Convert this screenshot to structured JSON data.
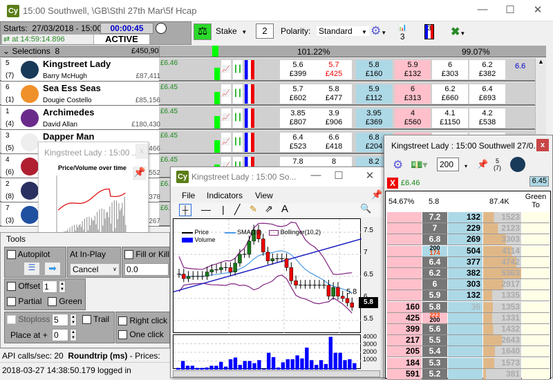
{
  "window": {
    "title": "15:00 Southwell,  \\GB\\Sthl 27th Mar\\5f Hcap",
    "logo": "Cy"
  },
  "info": {
    "starts_label": "Starts:",
    "starts_value": "27/03/2018 - 15:00",
    "countdown": "00:00:45",
    "refresh": "at 14:59:14.896",
    "status": "ACTIVE"
  },
  "toolbar": {
    "stake_label": "Stake",
    "stake_value": "2",
    "polarity_label": "Polarity:",
    "polarity_value": "Standard",
    "chart_count": "3",
    "ladder_count": "3"
  },
  "grid": {
    "selections_label": "Selections",
    "selections_count": "8",
    "matched": "£450,905",
    "back_book": "101.22%",
    "lay_book": "99.07%"
  },
  "runners": [
    {
      "num": "5",
      "draw": "(7)",
      "name": "Kingstreet Lady",
      "jockey": "Barry McHugh",
      "matched": "£87,411",
      "ltp_stake": "£6.46",
      "silk": "#1a3a5a",
      "prices": [
        [
          "5.6",
          "£399"
        ],
        [
          "5.7",
          "£425"
        ],
        [
          "5.8",
          "£160"
        ],
        [
          "5.9",
          "£132"
        ],
        [
          "6",
          "£303"
        ],
        [
          "6.2",
          "£382"
        ]
      ],
      "ltp": "6.6"
    },
    {
      "num": "6",
      "draw": "(1)",
      "name": "Sea Ess Seas",
      "jockey": "Dougie Costello",
      "matched": "£85,156",
      "ltp_stake": "£6.45",
      "silk": "#f0902a",
      "prices": [
        [
          "5.7",
          "£602"
        ],
        [
          "5.8",
          "£477"
        ],
        [
          "5.9",
          "£112"
        ],
        [
          "6",
          "£313"
        ],
        [
          "6.2",
          "£660"
        ],
        [
          "6.4",
          "£693"
        ]
      ],
      "ltp": ""
    },
    {
      "num": "1",
      "draw": "(4)",
      "name": "Archimedes",
      "jockey": "David Allan",
      "matched": "£180,430",
      "ltp_stake": "£6.45",
      "silk": "#6a2a8a",
      "prices": [
        [
          "3.85",
          "£807"
        ],
        [
          "3.9",
          "£906"
        ],
        [
          "3.95",
          "£369"
        ],
        [
          "4",
          "£560"
        ],
        [
          "4.1",
          "£1150"
        ],
        [
          "4.2",
          "£538"
        ]
      ],
      "ltp": ""
    },
    {
      "num": "3",
      "draw": "(5)",
      "name": "Dapper Man",
      "jockey": "",
      "matched": "£...466",
      "ltp_stake": "£6.45",
      "silk": "#eeeeee",
      "prices": [
        [
          "6.4",
          "£523"
        ],
        [
          "6.6",
          "£418"
        ],
        [
          "6.8",
          "£204"
        ],
        [
          "",
          ""
        ],
        [
          "",
          ""
        ],
        [
          "",
          ""
        ]
      ],
      "ltp": ""
    },
    {
      "num": "4",
      "draw": "(6)",
      "name": "",
      "jockey": "",
      "matched": "552",
      "ltp_stake": "£6.45",
      "silk": "#b02030",
      "prices": [
        [
          "7.8",
          ""
        ],
        [
          "8",
          ""
        ],
        [
          "8.2",
          ""
        ],
        [
          "",
          ""
        ],
        [
          "",
          ""
        ],
        [
          "",
          ""
        ]
      ],
      "ltp": ""
    },
    {
      "num": "2",
      "draw": "(8)",
      "name": "",
      "jockey": "",
      "matched": "378",
      "ltp_stake": "£6.",
      "silk": "#2a3060",
      "prices": [
        [
          "",
          ""
        ],
        [
          "",
          ""
        ],
        [
          "",
          ""
        ],
        [
          "",
          ""
        ],
        [
          "",
          ""
        ],
        [
          "",
          ""
        ]
      ],
      "ltp": ""
    },
    {
      "num": "7",
      "draw": "(3)",
      "name": "",
      "jockey": "",
      "matched": "267",
      "ltp_stake": "£6.",
      "silk": "#2050a0",
      "prices": [
        [
          "",
          ""
        ],
        [
          "",
          ""
        ],
        [
          "",
          ""
        ],
        [
          "",
          ""
        ],
        [
          "",
          ""
        ],
        [
          "",
          ""
        ]
      ],
      "ltp": ""
    }
  ],
  "mini_chart": {
    "title": "Kingstreet Lady : 15:00 ...",
    "chart_title": "Price/Volume over time"
  },
  "tools": {
    "title": "Tools",
    "autopilot": "Autopilot",
    "at_inplay": "At In-Play",
    "inplay_value": "Cancel",
    "fill_kill": "Fill or Kill",
    "fill_value": "0.0",
    "offset": "Offset",
    "offset_value": "1",
    "partial": "Partial",
    "green": "Green",
    "stoploss": "Stoploss",
    "stoploss_value": "5",
    "trail": "Trail",
    "place_at": "Place at +",
    "place_value": "0",
    "right_click": "Right click",
    "one_click": "One click"
  },
  "status": {
    "api": "API calls/sec:  20",
    "roundtrip": "Roundtrip (ms)",
    "prices": "-   Prices:",
    "log": "2018-03-27 14:38:50.179  logged in"
  },
  "chart_window": {
    "title": "Kingstreet Lady : 15:00 So...",
    "menu": [
      "File",
      "Indicators",
      "View"
    ],
    "legend": {
      "price": "Price",
      "sma": "SMA(10)",
      "bollinger": "Bollinger(10,2)",
      "volume": "Volume"
    },
    "last_label": "5.8",
    "current": "5.8"
  },
  "chart_data": {
    "type": "candlestick",
    "ylim": [
      5.2,
      7.8
    ],
    "yticks": [
      "7.5",
      "7",
      "6.5",
      "6",
      "5.5"
    ],
    "vol_ticks": [
      "4000",
      "3000",
      "2000",
      "1000"
    ],
    "volume": [
      200,
      1000,
      450,
      450,
      200,
      200,
      250,
      450,
      450,
      900,
      350,
      1200,
      1400,
      550,
      1000,
      1000,
      750,
      1100,
      100,
      1950,
      1450,
      250,
      850,
      1200,
      1200,
      1650,
      1300,
      2550,
      1100,
      550,
      1100,
      650,
      3800,
      1950,
      1950,
      1100,
      1200,
      750
    ]
  },
  "ladder": {
    "title": "Kingstreet Lady : 15:00 Southwell 27/0...",
    "stake": "200",
    "num": "5",
    "draw": "(7)",
    "pl": "£6.46",
    "ltp": "6.45",
    "hdr": [
      "54.67%",
      "5.8",
      "",
      "87.4K",
      "Green To"
    ],
    "rows": [
      {
        "lay": "",
        "price": "7.2",
        "back": "132",
        "vol": "1523",
        "v": 0.28
      },
      {
        "lay": "",
        "price": "7",
        "back": "229",
        "vol": "2123",
        "v": 0.39
      },
      {
        "lay": "",
        "price": "6.8",
        "back": "269",
        "vol": "3303",
        "v": 0.6
      },
      {
        "lay": "",
        "price": "200/174",
        "back": "504",
        "vol": "4114",
        "v": 0.75
      },
      {
        "lay": "",
        "price": "6.4",
        "back": "377",
        "vol": "4742",
        "v": 0.87
      },
      {
        "lay": "",
        "price": "6.2",
        "back": "382",
        "vol": "5363",
        "v": 1.0
      },
      {
        "lay": "",
        "price": "6",
        "back": "303",
        "vol": "2917",
        "v": 0.53
      },
      {
        "lay": "",
        "price": "5.9",
        "back": "132",
        "vol": "1335",
        "v": 0.24
      },
      {
        "lay": "160",
        "price": "5.8",
        "back": "36",
        "vol": "1353",
        "v": 0.25
      },
      {
        "lay": "425",
        "price": "223/200",
        "back": "",
        "vol": "1331",
        "v": 0.24
      },
      {
        "lay": "399",
        "price": "5.6",
        "back": "",
        "vol": "1432",
        "v": 0.26
      },
      {
        "lay": "217",
        "price": "5.5",
        "back": "",
        "vol": "2643",
        "v": 0.49
      },
      {
        "lay": "205",
        "price": "5.4",
        "back": "",
        "vol": "1640",
        "v": 0.31
      },
      {
        "lay": "184",
        "price": "5.3",
        "back": "",
        "vol": "1573",
        "v": 0.29
      },
      {
        "lay": "591",
        "price": "5.2",
        "back": "",
        "vol": "381",
        "v": 0.07
      }
    ]
  }
}
